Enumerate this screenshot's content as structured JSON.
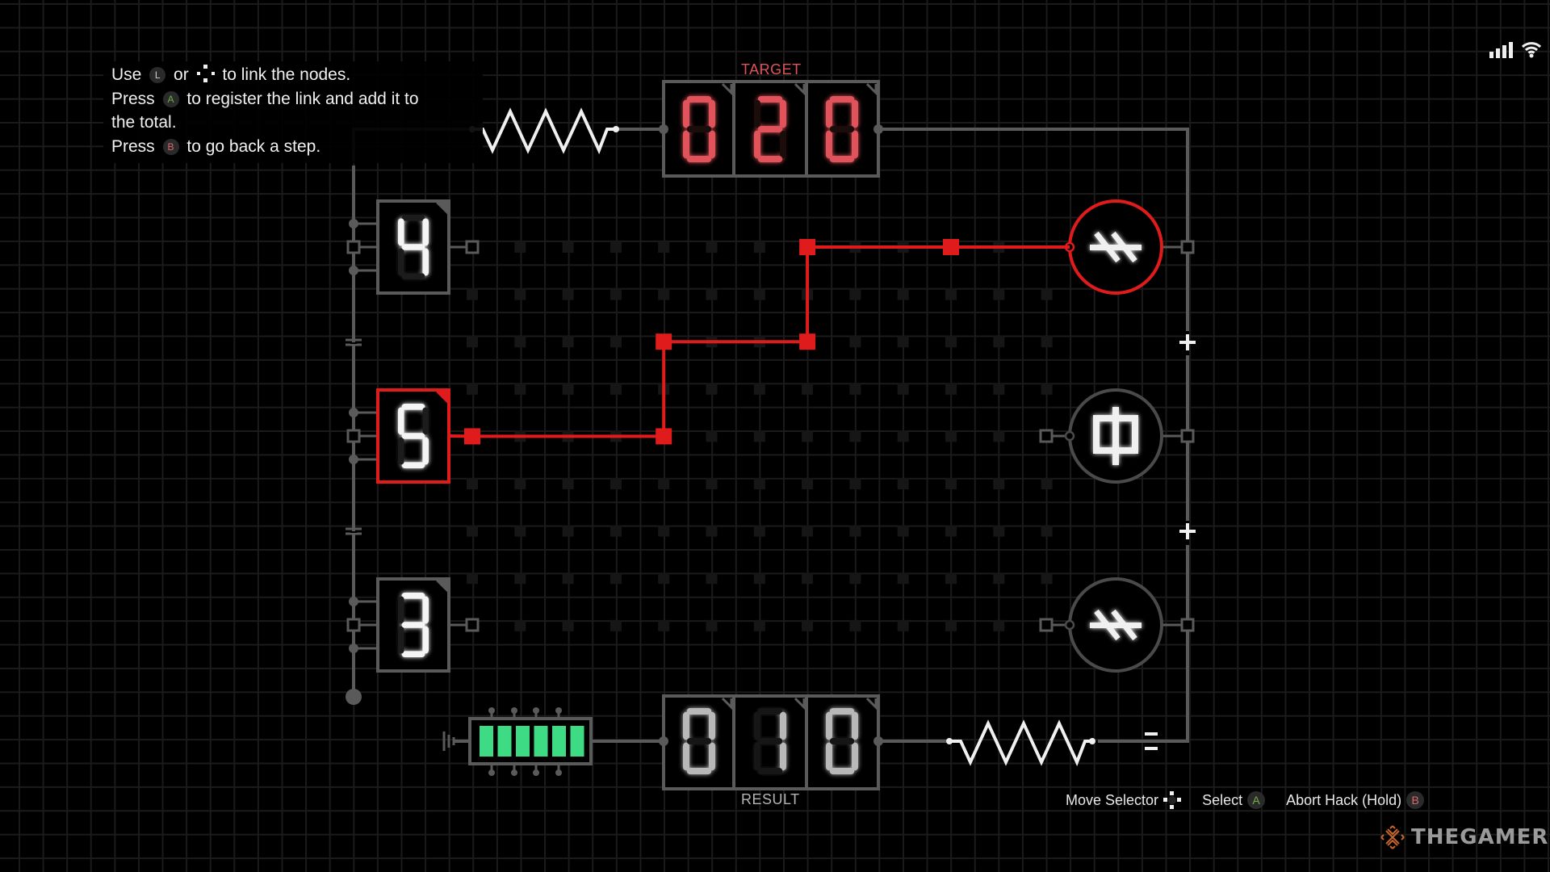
{
  "instructions": {
    "line1_pre": "Use",
    "line1_button_l": "L",
    "line1_mid": "or",
    "line1_post": "to link the nodes.",
    "line2_pre": "Press",
    "line2_button": "A",
    "line2_post": "to register the link and add it to",
    "line3": "the total.",
    "line4_pre": "Press",
    "line4_button": "B",
    "line4_post": "to go back a step."
  },
  "target": {
    "label": "TARGET",
    "digits": [
      "0",
      "2",
      "0"
    ],
    "value": 20
  },
  "result": {
    "label": "RESULT",
    "digits": [
      "0",
      "1",
      "0"
    ],
    "value": 10
  },
  "number_nodes": [
    {
      "value": "4",
      "selected": false
    },
    {
      "value": "5",
      "selected": true
    },
    {
      "value": "3",
      "selected": false
    }
  ],
  "operator_nodes": [
    {
      "symbol": "not-equal-slash-icon",
      "selected": true
    },
    {
      "symbol": "phi-icon",
      "selected": false
    },
    {
      "symbol": "not-equal-slash-icon",
      "selected": false
    }
  ],
  "operator_signs": [
    "+",
    "+",
    "="
  ],
  "battery": {
    "charge_bars_total": 6,
    "charge_bars_filled": 6,
    "color": "#3ddc84"
  },
  "link_path_nodes": [
    [
      0,
      4
    ],
    [
      4,
      4
    ],
    [
      4,
      2
    ],
    [
      7,
      2
    ],
    [
      7,
      0
    ],
    [
      10,
      0
    ]
  ],
  "controls": {
    "move_selector": "Move Selector",
    "select": "Select",
    "select_button": "A",
    "abort": "Abort Hack (Hold)",
    "abort_button": "B"
  },
  "status": {
    "signal_bars": 4,
    "wifi": "wifi-icon"
  },
  "watermark": "THEGAMER",
  "colors": {
    "accent_red": "#e01b1b",
    "target_red": "#e0535a",
    "wire_gray": "#5a5a5a",
    "digit_white": "#f5f5f5",
    "result_gray": "#b8b8b8"
  }
}
